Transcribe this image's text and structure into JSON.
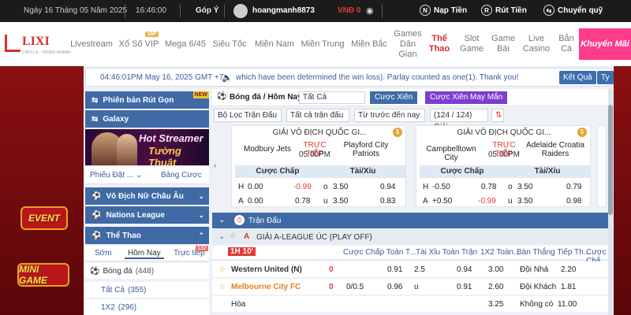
{
  "topbar": {
    "date": "Ngày 16 Tháng 05 Năm 2025",
    "time": "16:46:00",
    "feedback": "Góp Ý",
    "username": "hoangmanh8873",
    "balance": "VNĐ 0",
    "deposit": "Nạp Tiền",
    "withdraw": "Rút Tiền",
    "transfer": "Chuyển quỹ"
  },
  "logo": {
    "text": "LIXI",
    "tagline": "CHƠI LÀ - TRÚNG NHANH"
  },
  "nav": {
    "items": [
      "Livestream",
      "Xổ Số VIP",
      "Mega 6/45",
      "Siêu Tốc",
      "Miền Nam",
      "Miền Trung",
      "Miền Bắc",
      "Games Dân Gian",
      "Thể Thao",
      "Slot Game",
      "Game Bài",
      "Live Casino",
      "Bắn Cá"
    ],
    "vip_badge": "VIP",
    "promo": "Khuyến Mãi"
  },
  "left_banners": [
    "EVENT",
    "MINI GAME"
  ],
  "ticker": {
    "datetime": "04:46:01PM May 16, 2025 GMT +7",
    "message": "which have been determined the win loss). Parlay counted as one(1). Thank you!",
    "result_btn": "Kết Quả",
    "extra_btn": "Ty"
  },
  "sidebar": {
    "release_notes": "Phiên bản Rút Gọn",
    "new_badge": "NEW",
    "galaxy": "Galaxy",
    "stream_line1": "Hot Streamer",
    "stream_line2": "Tường Thuật",
    "tab_bet": "Phiếu Đặt ...",
    "tab_odds": "Bảng Cược",
    "cup": "Vô Địch Nữ Châu Âu",
    "nations": "Nations League",
    "sports": "Thể Thao",
    "tab_early": "Sớm",
    "tab_today": "Hôm Nay",
    "tab_live": "Trực tiếp",
    "live_count": "132",
    "football": "Bóng đá",
    "football_count": "(448)",
    "all": "Tất Cả",
    "all_count": "(355)",
    "onex2": "1X2",
    "onex2_count": "(296)"
  },
  "main": {
    "title": "Bóng đá / Hôm Nay",
    "sel_all": "Tất Cả",
    "btn_parlay": "Cược Xiên",
    "btn_lucky": "Cược Xiên May Mắn",
    "filter_match": "Bộ Lọc Trận Đấu",
    "filter_all_matches": "Tất cả trận đấu",
    "filter_before": "Từ trước đến nay",
    "filter_count": "(124 / 124) Giải"
  },
  "cards": [
    {
      "league": "GIẢI VÔ ĐỊCH QUỐC GI...",
      "home": "Modbury Jets",
      "live": "TRỰC TIẾP",
      "kickoff": "05:00PM",
      "away": "Playford City Patriots",
      "h1": "Cược Chấp",
      "h2": "Tài/Xỉu",
      "r1": [
        "H",
        "0.00",
        "-0.99",
        "o",
        "3.50",
        "0.94"
      ],
      "r2": [
        "A",
        "0.00",
        "0.78",
        "u",
        "3.50",
        "0.83"
      ]
    },
    {
      "league": "GIẢI VÔ ĐỊCH QUỐC GI...",
      "home": "Campbelltown City",
      "live": "TRỰC TIẾP",
      "kickoff": "05:00PM",
      "away": "Adelaide Croatia Raiders",
      "h1": "Cược Chấp",
      "h2": "Tài/Xỉu",
      "r1": [
        "H",
        "-0.50",
        "0.78",
        "o",
        "3.50",
        "0.79"
      ],
      "r2": [
        "A",
        "+0.50",
        "-0.99",
        "u",
        "3.50",
        "0.98"
      ]
    }
  ],
  "section": {
    "title": "Trận Đấu",
    "league": "GIẢI A-LEAGUE ÚC (PLAY OFF)"
  },
  "columns": [
    "Cược Chấp Toàn T...",
    "Tài Xỉu Toàn Trận",
    "1X2 Toàn...",
    "Bàn Thắng Tiếp Th...",
    "Cược Chấ"
  ],
  "match": {
    "time": "1H 10'",
    "home": "Western United (N)",
    "away": "Melbourne City FC",
    "draw": "Hòa",
    "home_score": "0",
    "away_score": "0",
    "hdp_home": "0.91",
    "hdp_line": "0/0.5",
    "hdp_away": "0.96",
    "ou_line": "2.5",
    "ou_over": "0.94",
    "ou_u": "u",
    "ou_under": "0.91",
    "x_home": "3.00",
    "x_away": "2.60",
    "x_draw": "3.25",
    "ng_home": "Đội Nhà",
    "ng_home_val": "2.20",
    "ng_away": "Đội Khách",
    "ng_away_val": "1.81",
    "ng_none": "Không có",
    "ng_none_val": "11.00"
  },
  "colors": {
    "accent": "#3f6aa6",
    "red": "#d32f2f",
    "negative": "#e53935"
  }
}
